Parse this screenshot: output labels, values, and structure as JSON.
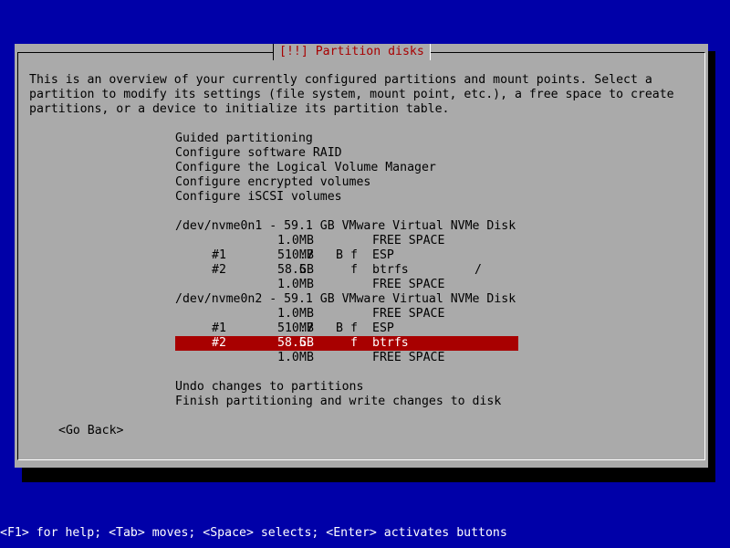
{
  "dialog": {
    "title": "[!!] Partition disks",
    "description": [
      "This is an overview of your currently configured partitions and mount points. Select a",
      "partition to modify its settings (file system, mount point, etc.), a free space to create",
      "partitions, or a device to initialize its partition table."
    ],
    "options": [
      "Guided partitioning",
      "Configure software RAID",
      "Configure the Logical Volume Manager",
      "Configure encrypted volumes",
      "Configure iSCSI volumes"
    ],
    "disks": [
      {
        "header": "/dev/nvme0n1 - 59.1 GB VMware Virtual NVMe Disk",
        "rows": [
          {
            "num": "",
            "size": "1.0",
            "unit": "MB",
            "boot": "",
            "f": "",
            "fs": "FREE SPACE",
            "mount": ""
          },
          {
            "num": "#1",
            "size": "510.7",
            "unit": "MB",
            "boot": "B",
            "f": "f",
            "fs": "ESP",
            "mount": ""
          },
          {
            "num": "#2",
            "size": "58.5",
            "unit": "GB",
            "boot": "",
            "f": "f",
            "fs": "btrfs",
            "mount": "/"
          },
          {
            "num": "",
            "size": "1.0",
            "unit": "MB",
            "boot": "",
            "f": "",
            "fs": "FREE SPACE",
            "mount": ""
          }
        ]
      },
      {
        "header": "/dev/nvme0n2 - 59.1 GB VMware Virtual NVMe Disk",
        "rows": [
          {
            "num": "",
            "size": "1.0",
            "unit": "MB",
            "boot": "",
            "f": "",
            "fs": "FREE SPACE",
            "mount": ""
          },
          {
            "num": "#1",
            "size": "510.7",
            "unit": "MB",
            "boot": "B",
            "f": "f",
            "fs": "ESP",
            "mount": ""
          },
          {
            "num": "#2",
            "size": "58.5",
            "unit": "GB",
            "boot": "",
            "f": "f",
            "fs": "btrfs",
            "mount": ""
          },
          {
            "num": "",
            "size": "1.0",
            "unit": "MB",
            "boot": "",
            "f": "",
            "fs": "FREE SPACE",
            "mount": ""
          }
        ]
      }
    ],
    "actions": [
      "Undo changes to partitions",
      "Finish partitioning and write changes to disk"
    ],
    "go_back": "<Go Back>"
  },
  "help_bar": "<F1> for help; <Tab> moves; <Space> selects; <Enter> activates buttons",
  "colors": {
    "background": "#0000a8",
    "dialog": "#aaaaaa",
    "title": "#a80000",
    "selection": "#a80000",
    "selection_text": "#ffffff"
  }
}
